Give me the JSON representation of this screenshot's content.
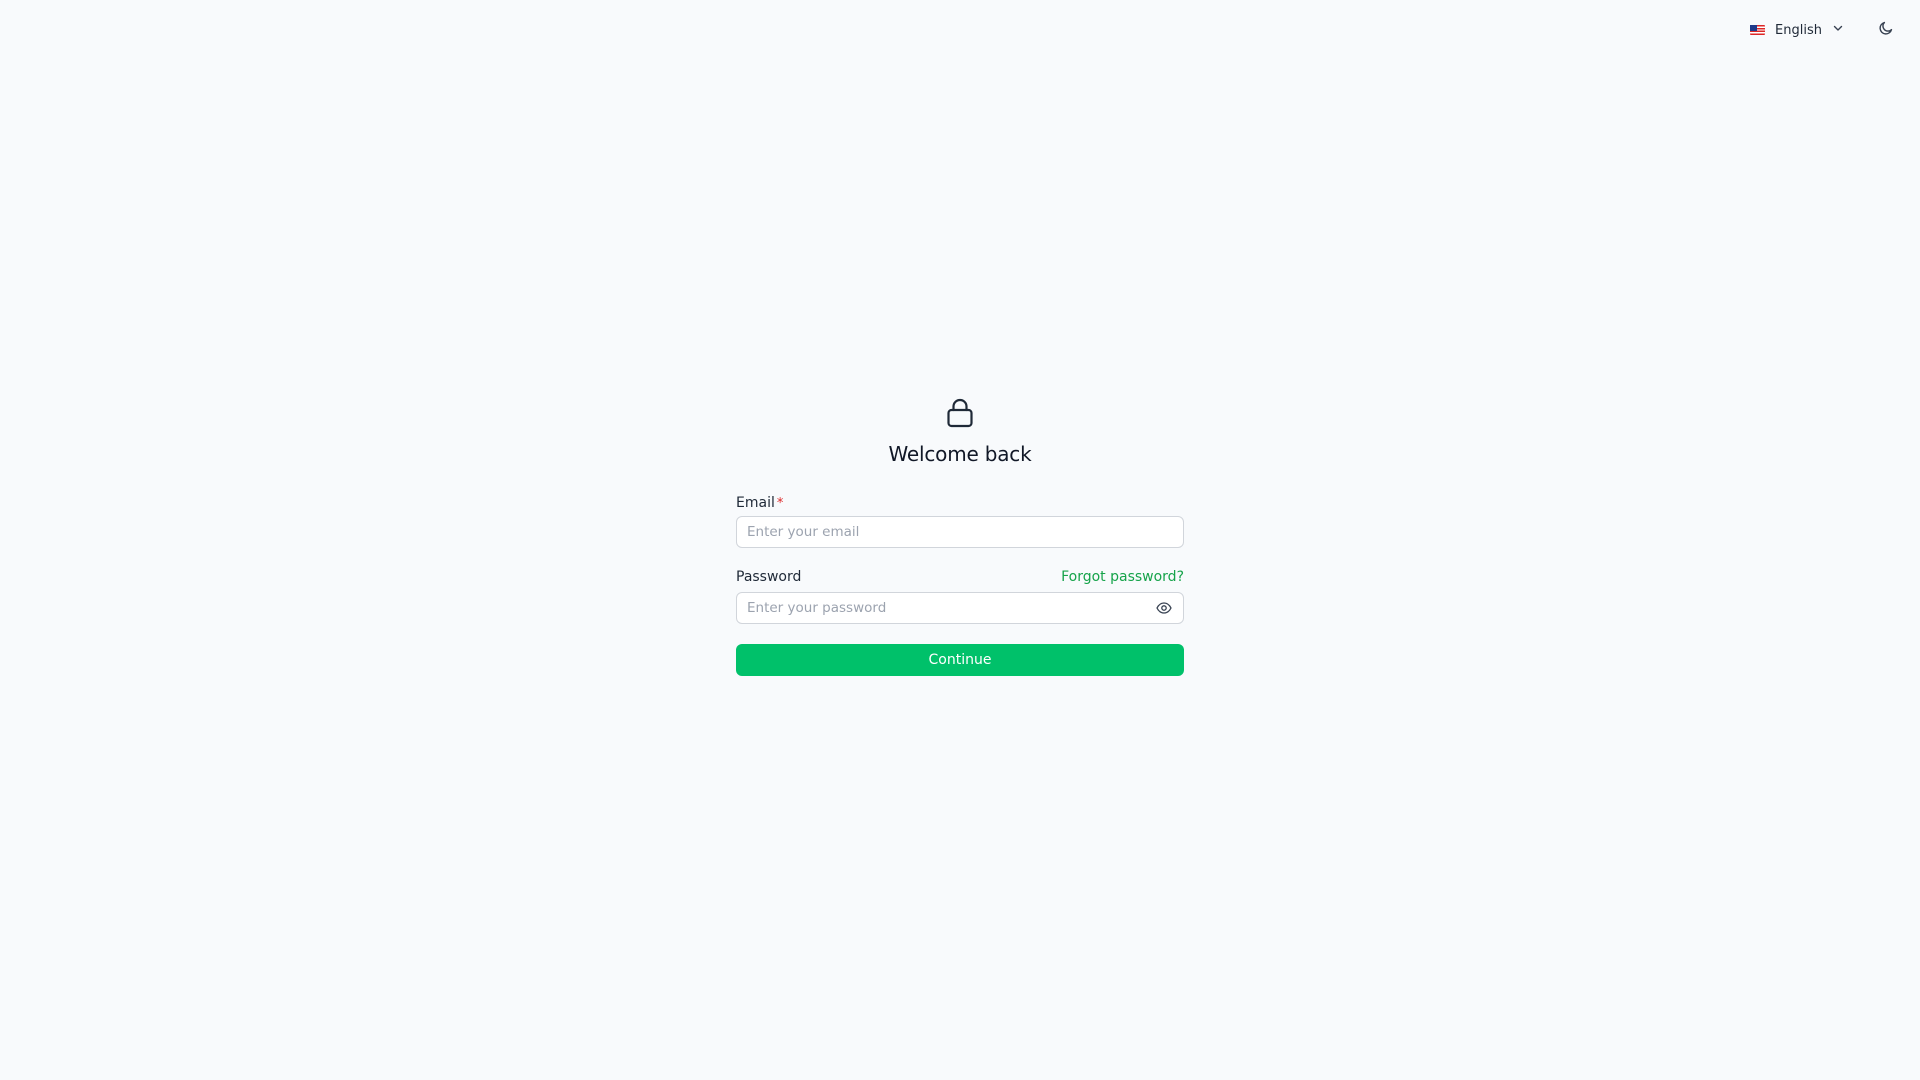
{
  "topbar": {
    "language": {
      "flag_icon": "us-flag-icon",
      "label": "English",
      "chevron_icon": "chevron-down-icon"
    },
    "theme_toggle_icon": "moon-icon"
  },
  "login": {
    "header_icon": "lock-icon",
    "title": "Welcome back",
    "email": {
      "label": "Email",
      "required_mark": "*",
      "placeholder": "Enter your email",
      "value": ""
    },
    "password": {
      "label": "Password",
      "forgot_link": "Forgot password?",
      "placeholder": "Enter your password",
      "value": "",
      "toggle_icon": "eye-icon"
    },
    "submit_label": "Continue"
  },
  "colors": {
    "background": "#f8fafc",
    "accent": "#00c16a",
    "link": "#16a34a",
    "required": "#dc2626",
    "input_border": "#d1d5db"
  }
}
